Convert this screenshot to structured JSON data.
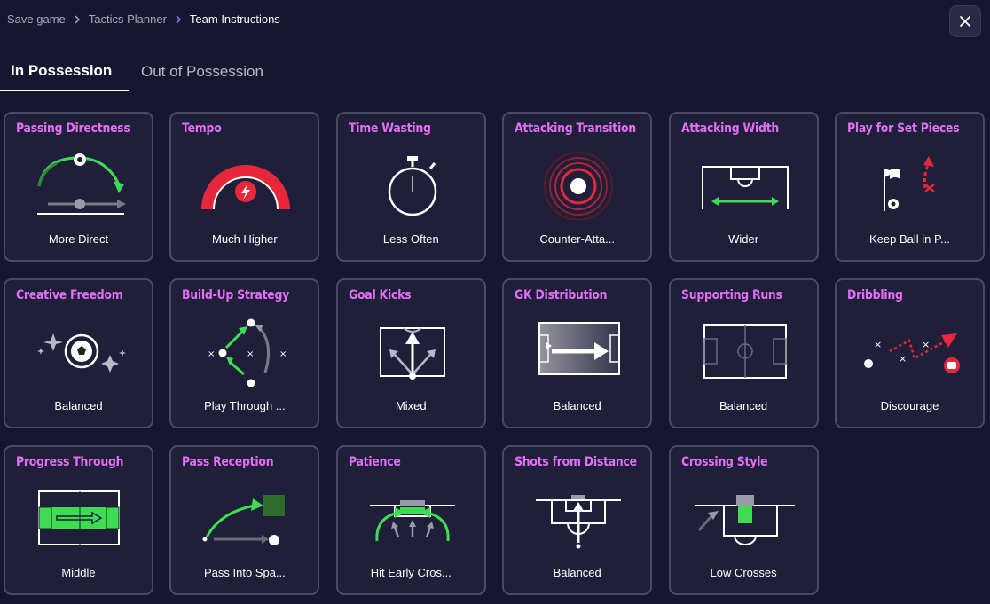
{
  "breadcrumb": {
    "items": [
      "Save game",
      "Tactics Planner",
      "Team Instructions"
    ]
  },
  "tabs": {
    "in_possession": "In Possession",
    "out_of_possession": "Out of Possession"
  },
  "colors": {
    "accent_title": "#e46ff7",
    "green": "#3ddc52",
    "red": "#e8283a",
    "card_bg": "#1f1f3a",
    "page_bg": "#161630"
  },
  "cards": [
    {
      "title": "Passing Directness",
      "value": "More Direct",
      "icon": "passing-directness-icon"
    },
    {
      "title": "Tempo",
      "value": "Much Higher",
      "icon": "tempo-gauge-icon"
    },
    {
      "title": "Time Wasting",
      "value": "Less Often",
      "icon": "stopwatch-icon"
    },
    {
      "title": "Attacking Transition",
      "value": "Counter-Atta...",
      "icon": "target-rings-icon"
    },
    {
      "title": "Attacking Width",
      "value": "Wider",
      "icon": "pitch-width-icon"
    },
    {
      "title": "Play for Set Pieces",
      "value": "Keep Ball in P...",
      "icon": "corner-flag-icon"
    },
    {
      "title": "Creative Freedom",
      "value": "Balanced",
      "icon": "sparkle-ball-icon"
    },
    {
      "title": "Build-Up Strategy",
      "value": "Play Through ...",
      "icon": "build-up-icon"
    },
    {
      "title": "Goal Kicks",
      "value": "Mixed",
      "icon": "goal-kick-icon"
    },
    {
      "title": "GK Distribution",
      "value": "Balanced",
      "icon": "gk-distribution-icon"
    },
    {
      "title": "Supporting Runs",
      "value": "Balanced",
      "icon": "pitch-icon"
    },
    {
      "title": "Dribbling",
      "value": "Discourage",
      "icon": "dribbling-icon"
    },
    {
      "title": "Progress Through",
      "value": "Middle",
      "icon": "progress-middle-icon"
    },
    {
      "title": "Pass Reception",
      "value": "Pass Into Spa...",
      "icon": "pass-reception-icon"
    },
    {
      "title": "Patience",
      "value": "Hit Early Cros...",
      "icon": "patience-icon"
    },
    {
      "title": "Shots from Distance",
      "value": "Balanced",
      "icon": "shots-distance-icon"
    },
    {
      "title": "Crossing Style",
      "value": "Low Crosses",
      "icon": "crossing-style-icon"
    }
  ]
}
